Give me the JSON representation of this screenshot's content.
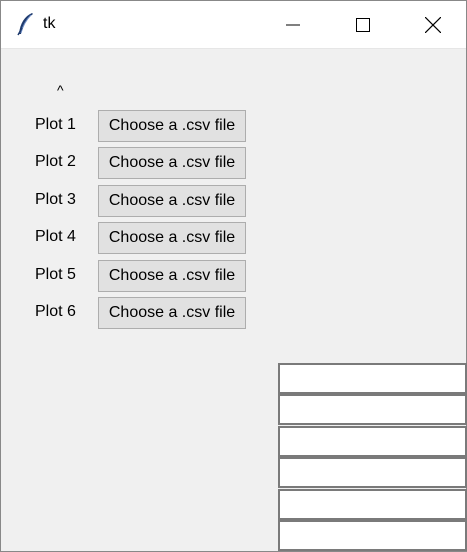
{
  "window": {
    "title": "tk",
    "controls": {
      "minimize": "minimize",
      "maximize": "maximize",
      "close": "close"
    }
  },
  "main": {
    "caret": "^",
    "rows": [
      {
        "label": "Plot 1",
        "button": "Choose a .csv file"
      },
      {
        "label": "Plot 2",
        "button": "Choose a .csv file"
      },
      {
        "label": "Plot 3",
        "button": "Choose a .csv file"
      },
      {
        "label": "Plot 4",
        "button": "Choose a .csv file"
      },
      {
        "label": "Plot 5",
        "button": "Choose a .csv file"
      },
      {
        "label": "Plot 6",
        "button": "Choose a .csv file"
      }
    ],
    "entries": [
      "",
      "",
      "",
      "",
      "",
      ""
    ]
  },
  "colors": {
    "background": "#f0f0f0",
    "button_face": "#e1e1e1",
    "button_border": "#adadad",
    "entry_border": "#7a7a7a"
  }
}
